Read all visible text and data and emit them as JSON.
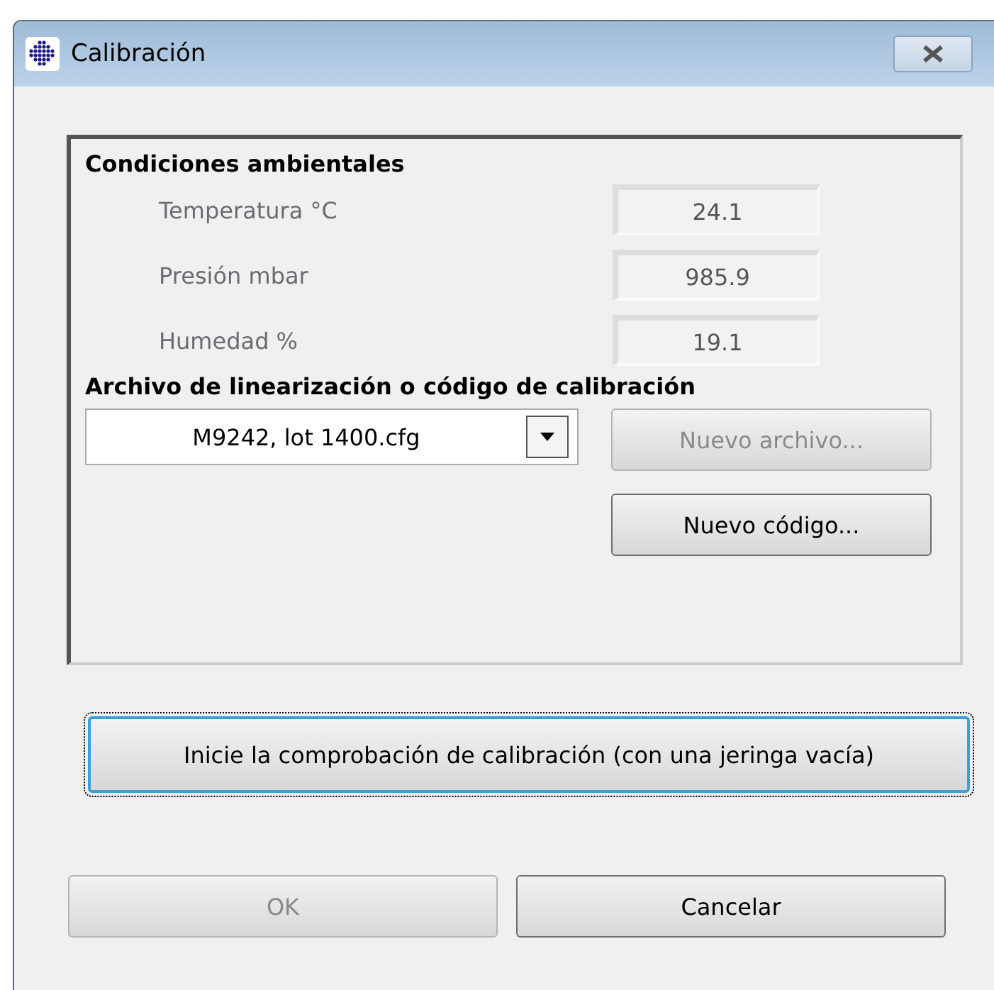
{
  "window": {
    "title": "Calibración"
  },
  "conditions": {
    "heading": "Condiciones ambientales",
    "rows": [
      {
        "label": "Temperatura °C",
        "value": "24.1"
      },
      {
        "label": "Presión mbar",
        "value": "985.9"
      },
      {
        "label": "Humedad %",
        "value": "19.1"
      }
    ]
  },
  "calibration": {
    "heading": "Archivo de linearización o código de calibración",
    "file": "M9242, lot 1400.cfg",
    "buttons": [
      {
        "label": "Nuevo archivo...",
        "disabled": true
      },
      {
        "label": "Nuevo código...",
        "disabled": false
      }
    ]
  },
  "start_button": {
    "label": "Inicie la comprobación de calibración (con una jeringa vacía)",
    "focused": true
  },
  "buttons": [
    {
      "label": "OK",
      "disabled": true
    },
    {
      "label": "Cancelar",
      "disabled": false
    }
  ]
}
